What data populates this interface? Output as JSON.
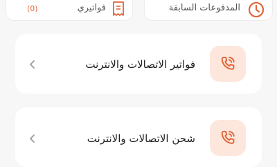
{
  "quick_actions": {
    "past_payments": {
      "label": "المدفوعات السابقة",
      "icon": "clock-icon"
    },
    "my_bills": {
      "label": "فواتيري",
      "count": "(0)",
      "icon": "receipt-icon"
    }
  },
  "services": [
    {
      "label": "فواتير الاتصالات والانترنت",
      "icon": "phone-call-icon"
    },
    {
      "label": "شحن الاتصالات والانترنت",
      "icon": "phone-call-icon"
    }
  ],
  "colors": {
    "accent": "#e0663a",
    "icon_bg": "#fde6dc",
    "background": "#f7f7f8"
  }
}
